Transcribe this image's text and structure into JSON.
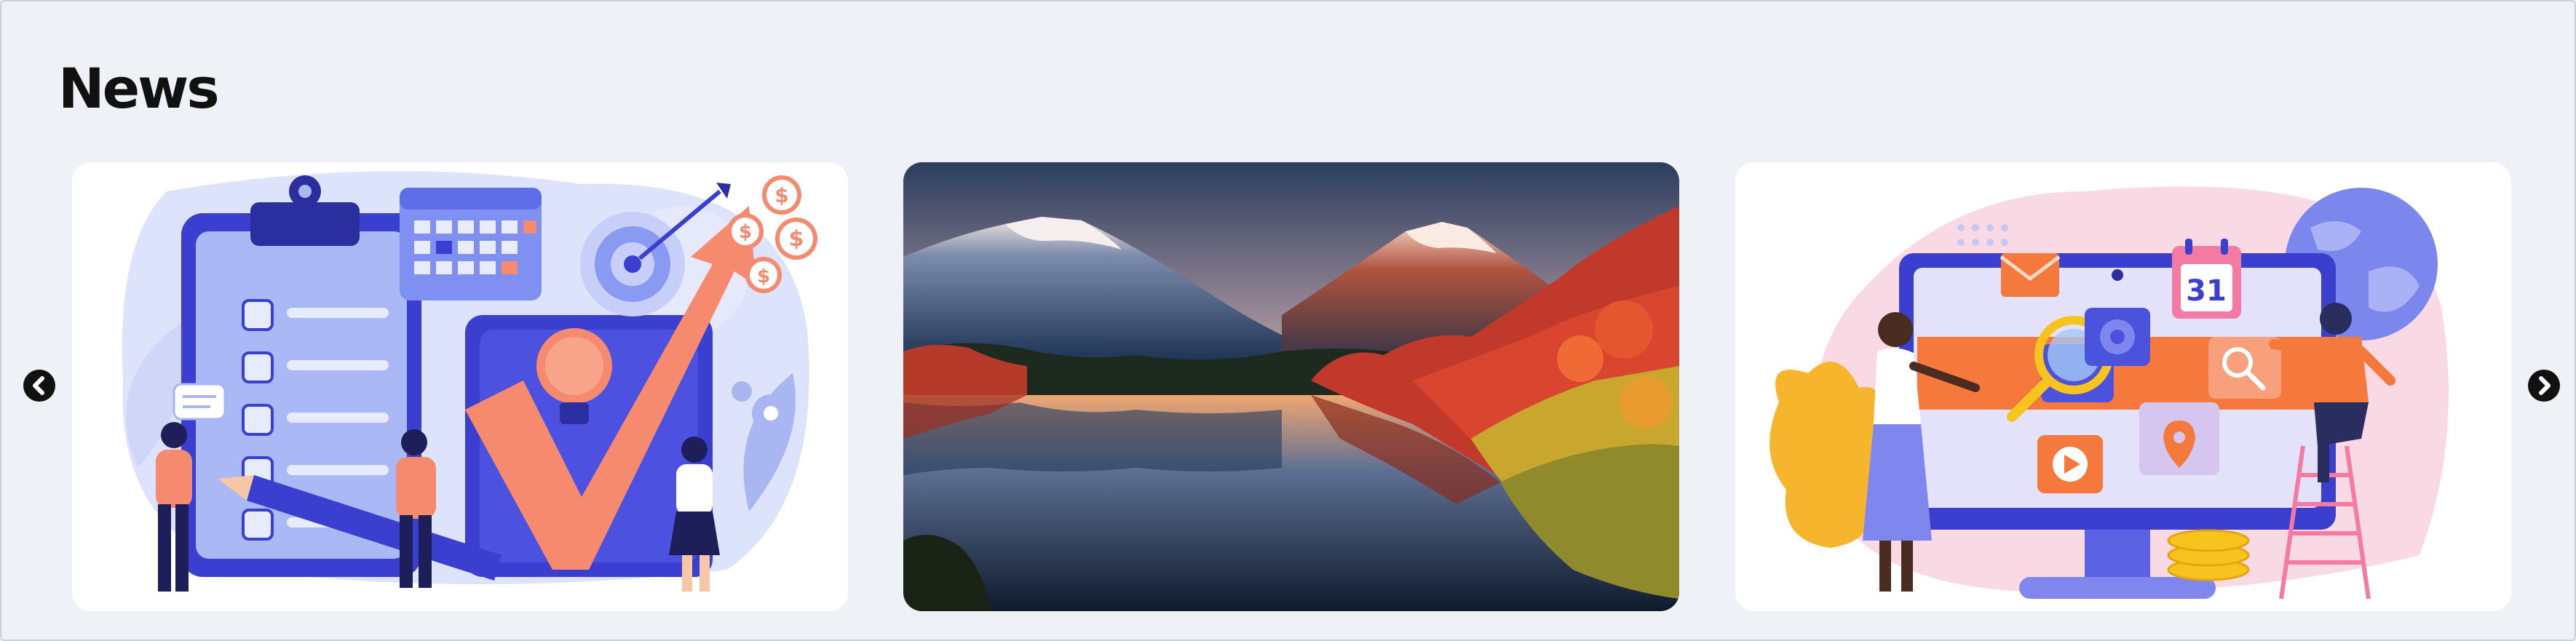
{
  "section": {
    "title": "News"
  },
  "carousel": {
    "prev_icon": "chevron-left-icon",
    "next_icon": "chevron-right-icon",
    "cards": [
      {
        "image": "planning-illustration"
      },
      {
        "image": "mountain-lake-landscape"
      },
      {
        "image": "digital-marketing-illustration",
        "calendar_day": "31"
      }
    ]
  }
}
